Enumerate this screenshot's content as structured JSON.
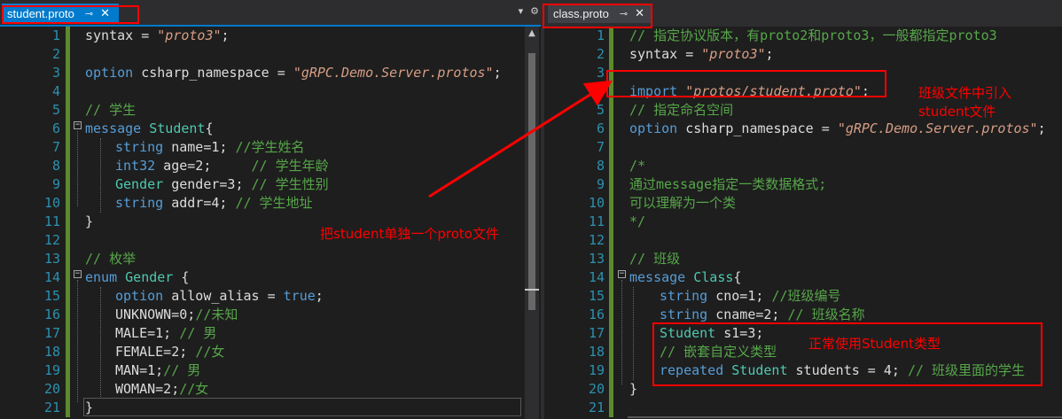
{
  "left_tab": {
    "title": "student.proto",
    "pin": "⊸",
    "close": "✕"
  },
  "right_tab": {
    "title": "class.proto",
    "pin": "⊸",
    "close": "✕"
  },
  "tab_actions": {
    "dropdown": "▾",
    "settings": "⚙"
  },
  "left_numbers": [
    "1",
    "2",
    "3",
    "4",
    "5",
    "6",
    "7",
    "8",
    "9",
    "10",
    "11",
    "12",
    "13",
    "14",
    "15",
    "16",
    "17",
    "18",
    "19",
    "20",
    "21"
  ],
  "right_numbers": [
    "1",
    "2",
    "3",
    "4",
    "5",
    "6",
    "7",
    "8",
    "9",
    "10",
    "11",
    "12",
    "13",
    "14",
    "15",
    "16",
    "17",
    "18",
    "19",
    "20",
    "21"
  ],
  "left_code": {
    "l1": {
      "a": "syntax = ",
      "b": "\"proto3\"",
      "c": ";"
    },
    "l3": {
      "a": "option",
      "b": " csharp_namespace = ",
      "c": "\"gRPC.Demo.Server.protos\"",
      "d": ";"
    },
    "l5": "// 学生",
    "l6": {
      "a": "message",
      "b": " Student",
      "c": "{"
    },
    "l7": {
      "a": "string",
      "b": " name=1; ",
      "c": "//学生姓名"
    },
    "l8": {
      "a": "int32",
      "b": " age=2;     ",
      "c": "// 学生年龄"
    },
    "l9": {
      "a": "Gender",
      "b": " gender=3; ",
      "c": "// 学生性别"
    },
    "l10": {
      "a": "string",
      "b": " addr=4; ",
      "c": "// 学生地址"
    },
    "l11": "}",
    "l13": "// 枚举",
    "l14": {
      "a": "enum",
      "b": " Gender",
      "c": " {"
    },
    "l15": {
      "a": "option",
      "b": " allow_alias = ",
      "c": "true",
      "d": ";"
    },
    "l16": {
      "a": "UNKNOWN=0;",
      "b": "//未知"
    },
    "l17": {
      "a": "MALE=1; ",
      "b": "// 男"
    },
    "l18": {
      "a": "FEMALE=2; ",
      "b": "//女"
    },
    "l19": {
      "a": "MAN=1;",
      "b": "// 男"
    },
    "l20": {
      "a": "WOMAN=2;",
      "b": "//女"
    },
    "l21": "}"
  },
  "right_code": {
    "l1": "// 指定协议版本，有proto2和proto3，一般都指定proto3",
    "l2": {
      "a": "syntax = ",
      "b": "\"proto3\"",
      "c": ";"
    },
    "l4": {
      "a": "import ",
      "b": "\"protos/student.proto\"",
      "c": ";"
    },
    "l5": "// 指定命名空间",
    "l6": {
      "a": "option",
      "b": " csharp_namespace = ",
      "c": "\"gRPC.Demo.Server.protos\"",
      "d": ";"
    },
    "l8": "/*",
    "l9": "通过message指定一类数据格式;",
    "l10": "可以理解为一个类",
    "l11": "*/",
    "l13": "// 班级",
    "l14": {
      "a": "message",
      "b": " Class",
      "c": "{"
    },
    "l15": {
      "a": "string",
      "b": " cno=1; ",
      "c": "//班级编号"
    },
    "l16": {
      "a": "string",
      "b": " cname=2; ",
      "c": "// 班级名称"
    },
    "l17": {
      "a": "Student",
      "b": " s1=3;"
    },
    "l18": "// 嵌套自定义类型",
    "l19": {
      "a": "repeated",
      "b": " Student",
      "c": " students = 4; ",
      "d": "// 班级里面的学生"
    },
    "l20": "}"
  },
  "annotations": {
    "separate_file": "把student单独一个proto文件",
    "import_line1": "班级文件中引入",
    "import_line2": "student文件",
    "use_type": "正常使用Student类型"
  },
  "colors": {
    "annotation": "#ff0000",
    "accent": "#007acc",
    "change_bar": "#5b8b2c"
  }
}
